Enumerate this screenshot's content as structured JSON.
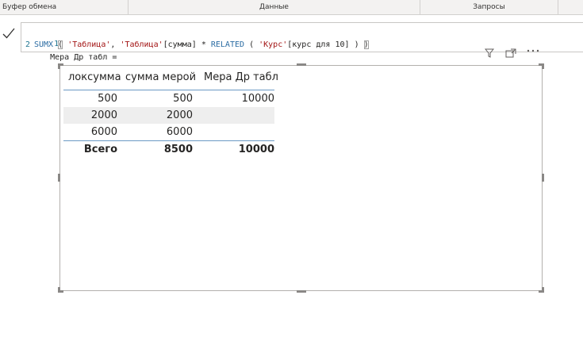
{
  "ribbon": {
    "groups": [
      "Буфер обмена",
      "Данные",
      "Запросы"
    ]
  },
  "formula": {
    "commit_icon": "checkmark-icon",
    "line1_number": "1",
    "line1_text": "Мера Др табл =",
    "line2_number": "2",
    "fn_sumx": "SUMX",
    "paren_open": "(",
    "arg_table": "'Таблица'",
    "comma": ",",
    "arg_column": "'Таблица'",
    "arg_column_field": "[сумма]",
    "op_multiply": "*",
    "fn_related": "RELATED",
    "related_open": "(",
    "related_table": "'Курс'",
    "related_field": "[курс для 10]",
    "related_close": ")",
    "paren_close": ")"
  },
  "visual_header": {
    "icons": [
      "filter-icon",
      "focus-mode-icon",
      "more-options-icon"
    ]
  },
  "table": {
    "columns": [
      "локсумма",
      "сумма мерой",
      "Мера Др табл"
    ],
    "rows": [
      [
        "500",
        "500",
        "10000"
      ],
      [
        "2000",
        "2000",
        ""
      ],
      [
        "6000",
        "6000",
        ""
      ]
    ],
    "total": [
      "Всего",
      "8500",
      "10000"
    ]
  },
  "colors": {
    "header_rule": "#6b9ac4",
    "alt_row": "#eeeeee",
    "dax_keyword": "#2b6ca3",
    "dax_string": "#a31515"
  }
}
